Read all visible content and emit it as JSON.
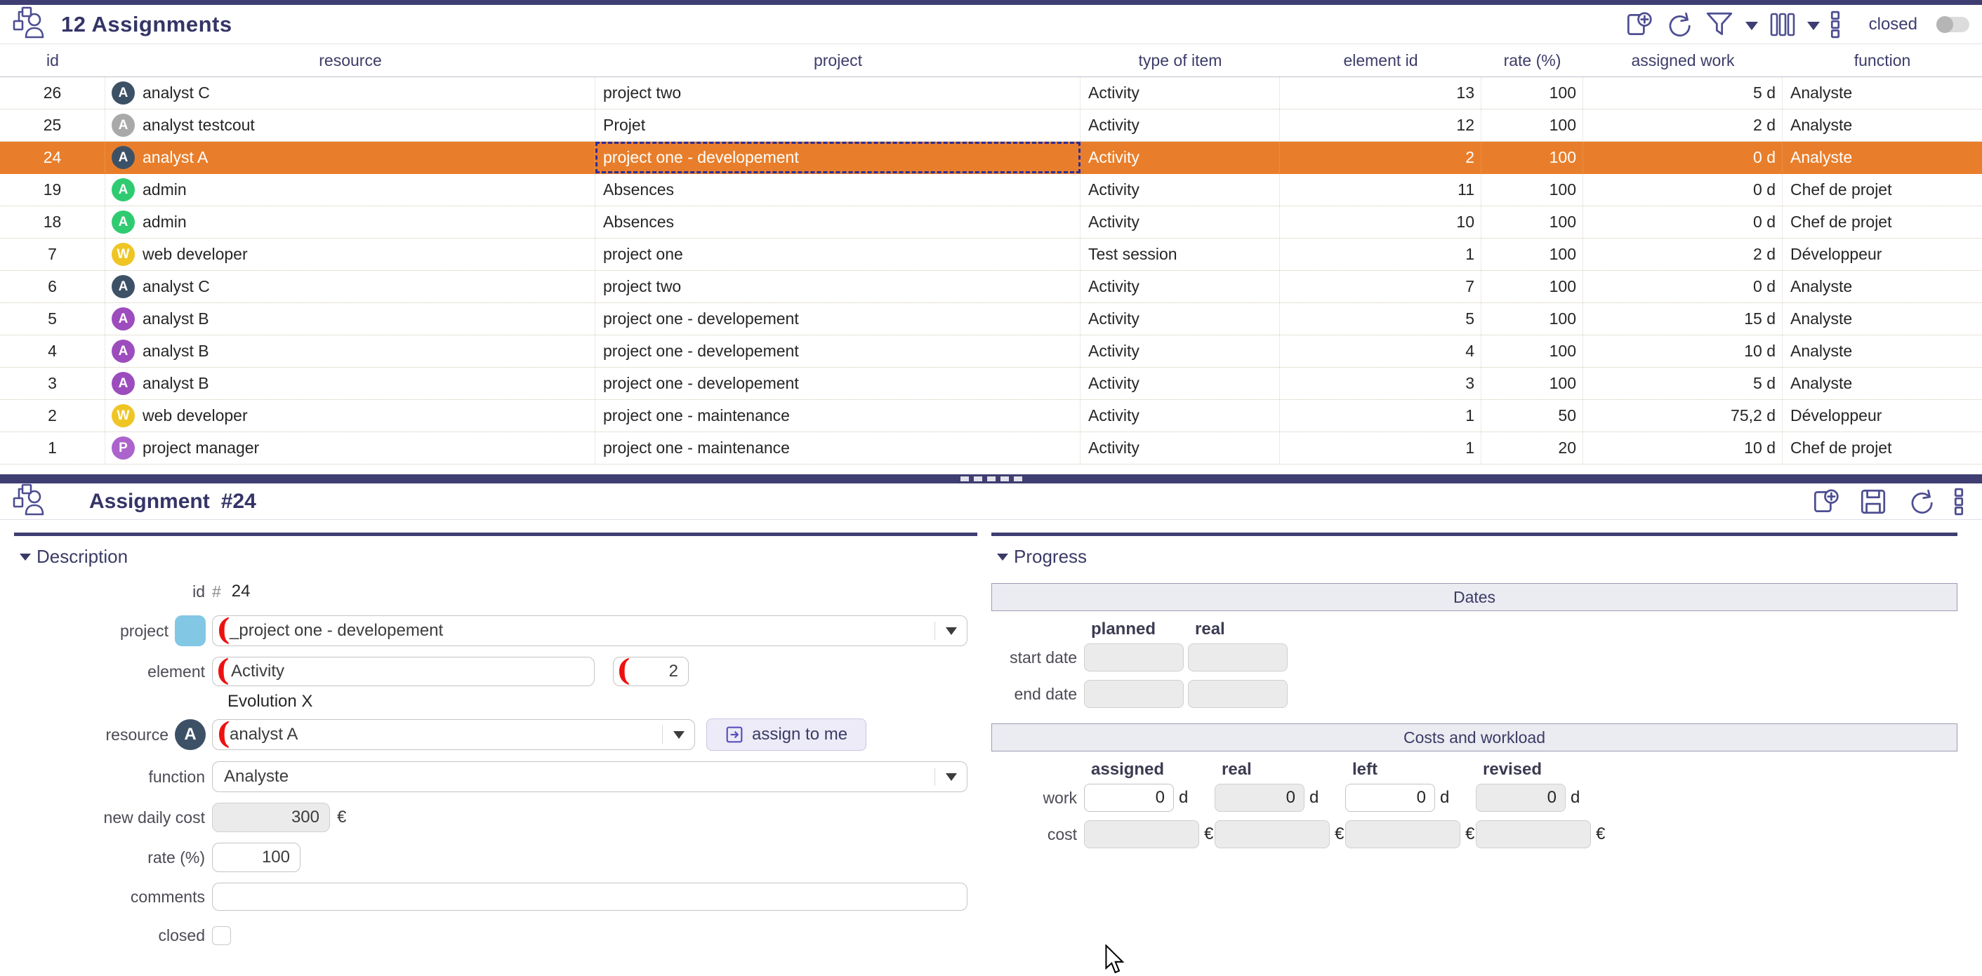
{
  "toolbar": {
    "title": "12 Assignments",
    "closed_label": "closed"
  },
  "table": {
    "columns": [
      "id",
      "resource",
      "project",
      "type of item",
      "element id",
      "rate (%)",
      "assigned work",
      "function"
    ],
    "rows": [
      {
        "id": "26",
        "resource": "analyst C",
        "avatar": "A",
        "avatar_color": "#3d5166",
        "project": "project two",
        "type": "Activity",
        "element_id": "13",
        "rate": "100",
        "assigned_work": "5 d",
        "function": "Analyste",
        "selected": false
      },
      {
        "id": "25",
        "resource": "analyst testcout",
        "avatar": "A",
        "avatar_color": "#a9a9a9",
        "project": "Projet",
        "type": "Activity",
        "element_id": "12",
        "rate": "100",
        "assigned_work": "2 d",
        "function": "Analyste",
        "selected": false
      },
      {
        "id": "24",
        "resource": "analyst A",
        "avatar": "A",
        "avatar_color": "#3d5166",
        "project": "project one - developement",
        "type": "Activity",
        "element_id": "2",
        "rate": "100",
        "assigned_work": "0 d",
        "function": "Analyste",
        "selected": true
      },
      {
        "id": "19",
        "resource": "admin",
        "avatar": "A",
        "avatar_color": "#2fcb71",
        "project": "Absences",
        "type": "Activity",
        "element_id": "11",
        "rate": "100",
        "assigned_work": "0 d",
        "function": "Chef de projet",
        "selected": false
      },
      {
        "id": "18",
        "resource": "admin",
        "avatar": "A",
        "avatar_color": "#2fcb71",
        "project": "Absences",
        "type": "Activity",
        "element_id": "10",
        "rate": "100",
        "assigned_work": "0 d",
        "function": "Chef de projet",
        "selected": false
      },
      {
        "id": "7",
        "resource": "web developer",
        "avatar": "W",
        "avatar_color": "#efc524",
        "project": "project one",
        "type": "Test session",
        "element_id": "1",
        "rate": "100",
        "assigned_work": "2 d",
        "function": "Développeur",
        "selected": false
      },
      {
        "id": "6",
        "resource": "analyst C",
        "avatar": "A",
        "avatar_color": "#3d5166",
        "project": "project two",
        "type": "Activity",
        "element_id": "7",
        "rate": "100",
        "assigned_work": "0 d",
        "function": "Analyste",
        "selected": false
      },
      {
        "id": "5",
        "resource": "analyst B",
        "avatar": "A",
        "avatar_color": "#9d4cbd",
        "project": "project one - developement",
        "type": "Activity",
        "element_id": "5",
        "rate": "100",
        "assigned_work": "15 d",
        "function": "Analyste",
        "selected": false
      },
      {
        "id": "4",
        "resource": "analyst B",
        "avatar": "A",
        "avatar_color": "#9d4cbd",
        "project": "project one - developement",
        "type": "Activity",
        "element_id": "4",
        "rate": "100",
        "assigned_work": "10 d",
        "function": "Analyste",
        "selected": false
      },
      {
        "id": "3",
        "resource": "analyst B",
        "avatar": "A",
        "avatar_color": "#9d4cbd",
        "project": "project one - developement",
        "type": "Activity",
        "element_id": "3",
        "rate": "100",
        "assigned_work": "5 d",
        "function": "Analyste",
        "selected": false
      },
      {
        "id": "2",
        "resource": "web developer",
        "avatar": "W",
        "avatar_color": "#efc524",
        "project": "project one - maintenance",
        "type": "Activity",
        "element_id": "1",
        "rate": "50",
        "assigned_work": "75,2 d",
        "function": "Développeur",
        "selected": false
      },
      {
        "id": "1",
        "resource": "project manager",
        "avatar": "P",
        "avatar_color": "#ac64cc",
        "project": "project one - maintenance",
        "type": "Activity",
        "element_id": "1",
        "rate": "20",
        "assigned_work": "10 d",
        "function": "Chef de projet",
        "selected": false
      }
    ]
  },
  "detail": {
    "header_title": "Assignment",
    "header_number": "#24",
    "description": {
      "section_title": "Description",
      "id_label": "id",
      "id_hash": "#",
      "id_value": "24",
      "project_label": "project",
      "project_value": "_project one - developement",
      "project_color": "#82c8e4",
      "element_label": "element",
      "element_value": "Activity",
      "element_num": "2",
      "element_extra": "Evolution X",
      "resource_label": "resource",
      "resource_avatar": "A",
      "resource_avatar_color": "#3d5166",
      "resource_value": "analyst A",
      "assign_button": "assign to me",
      "function_label": "function",
      "function_value": "Analyste",
      "daily_cost_label": "new daily cost",
      "daily_cost_value": "300",
      "daily_cost_unit": "€",
      "rate_label": "rate (%)",
      "rate_value": "100",
      "comments_label": "comments",
      "comments_value": "",
      "closed_label": "closed",
      "closed_checked": false
    },
    "progress": {
      "section_title": "Progress",
      "dates_title": "Dates",
      "col_planned": "planned",
      "col_real": "real",
      "start_label": "start date",
      "end_label": "end date",
      "costs_title": "Costs and workload",
      "col_assigned": "assigned",
      "col_real2": "real",
      "col_left": "left",
      "col_revised": "revised",
      "work_label": "work",
      "cost_label": "cost",
      "work_values": {
        "assigned": "0",
        "real": "0",
        "left": "0",
        "revised": "0"
      },
      "work_unit": "d",
      "cost_unit": "€"
    }
  }
}
